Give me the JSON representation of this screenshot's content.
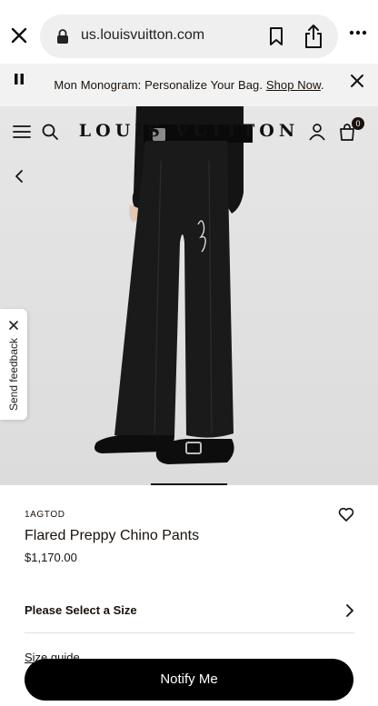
{
  "browser": {
    "url": "us.louisvuitton.com",
    "icons": [
      "close-icon",
      "lock-icon",
      "bookmark-icon",
      "share-icon",
      "more-icon"
    ]
  },
  "promo_banner": {
    "text": "Mon Monogram: Personalize Your Bag.",
    "link_text": "Shop Now",
    "trailing": "."
  },
  "header": {
    "logo_text": "LOUIS VUITTON",
    "bag_count": "0"
  },
  "feedback": {
    "label": "Send feedback"
  },
  "product": {
    "sku": "1AGTOD",
    "name": "Flared Preppy Chino Pants",
    "price": "$1,170.00"
  },
  "size_selector": {
    "label": "Please Select a Size"
  },
  "size_guide": {
    "label": "Size guide"
  },
  "cta": {
    "label": "Notify Me"
  },
  "colors": {
    "brand_dark": "#19110b",
    "promo_bg": "#f2f2f2",
    "url_bg": "#efefef",
    "cta_bg": "#000000"
  }
}
